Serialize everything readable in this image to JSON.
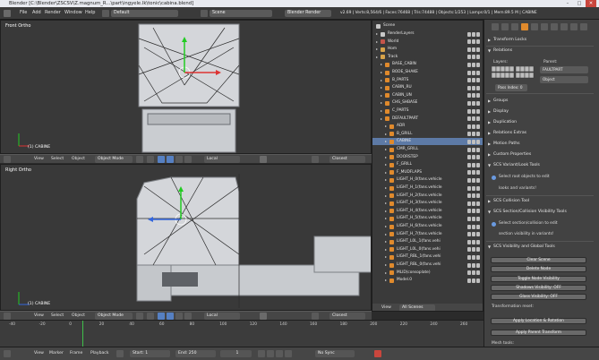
{
  "title": "Blender [C:\\Blender\\ZSCSV\\Z.magnum_R...\\part\\ingyele.lk\\tonic\\cabina.blend]",
  "window_controls": {
    "min": "–",
    "max": "□",
    "close": "✕"
  },
  "menu": [
    "File",
    "Add",
    "Render",
    "Window",
    "Help"
  ],
  "layout_select": "Default",
  "scene_select": "Scene",
  "engine_select": "Blender Render",
  "stats": "v2.69 | Verts:8,564/6 | Faces:76468 | Tris:74488 | Objects:1/253 | Lamps:0/1 | Mem:89.5 M | CABINE",
  "viewport_top": {
    "label": "Front Ortho",
    "object_name": "(1) CABINE"
  },
  "viewport_bottom": {
    "label": "Right Ortho",
    "object_name": "(1) CABINE"
  },
  "view_header": {
    "view": "View",
    "select": "Select",
    "object": "Object",
    "mode": "Object Mode",
    "orientation": "Local",
    "snap": "Closest"
  },
  "outliner": {
    "root": "Scene",
    "rows": [
      {
        "label": "RenderLayers",
        "indent": 1,
        "color": "#c8c8c8"
      },
      {
        "label": "World",
        "indent": 1,
        "color": "#c4554a"
      },
      {
        "label": "Hom",
        "indent": 1,
        "color": "#d7a34a"
      },
      {
        "label": "Track",
        "indent": 1,
        "color": "#d7a34a"
      },
      {
        "label": "BASE_CABIN",
        "indent": 2,
        "color": "#e08a2c"
      },
      {
        "label": "BODE_SHAKE",
        "indent": 2,
        "color": "#e08a2c"
      },
      {
        "label": "B_PARTS",
        "indent": 2,
        "color": "#e08a2c"
      },
      {
        "label": "CABIN_RU",
        "indent": 2,
        "color": "#e08a2c"
      },
      {
        "label": "CABIN_UN",
        "indent": 2,
        "color": "#e08a2c"
      },
      {
        "label": "CHS_SHBASE",
        "indent": 2,
        "color": "#e08a2c"
      },
      {
        "label": "C_PARTS",
        "indent": 2,
        "color": "#e08a2c"
      },
      {
        "label": "DEFAULTPART",
        "indent": 2,
        "color": "#e08a2c"
      },
      {
        "label": "ADR",
        "indent": 3,
        "color": "#e08a2c"
      },
      {
        "label": "B_GRILL",
        "indent": 3,
        "color": "#e08a2c"
      },
      {
        "label": "CABINE",
        "indent": 3,
        "color": "#e08a2c",
        "selected": true
      },
      {
        "label": "CMR_GRILL",
        "indent": 3,
        "color": "#e08a2c"
      },
      {
        "label": "DOORSTEP",
        "indent": 3,
        "color": "#e08a2c"
      },
      {
        "label": "F_GRILL",
        "indent": 3,
        "color": "#e08a2c"
      },
      {
        "label": "F_MUDFLAPS",
        "indent": 3,
        "color": "#e08a2c"
      },
      {
        "label": "LIGHT_H_0(fans.vehicle",
        "indent": 3,
        "color": "#e08a2c"
      },
      {
        "label": "LIGHT_H_1(fans.vehicle",
        "indent": 3,
        "color": "#e08a2c"
      },
      {
        "label": "LIGHT_H_2(fans.vehicle",
        "indent": 3,
        "color": "#e08a2c"
      },
      {
        "label": "LIGHT_H_3(fans.vehicle",
        "indent": 3,
        "color": "#e08a2c"
      },
      {
        "label": "LIGHT_H_4(fans.vehicle",
        "indent": 3,
        "color": "#e08a2c"
      },
      {
        "label": "LIGHT_H_5(fans.vehicle",
        "indent": 3,
        "color": "#e08a2c"
      },
      {
        "label": "LIGHT_H_6(fans.vehicle",
        "indent": 3,
        "color": "#e08a2c"
      },
      {
        "label": "LIGHT_H_7(fans.vehicle",
        "indent": 3,
        "color": "#e08a2c"
      },
      {
        "label": "LIGHT_L0L_1(fans.vehi",
        "indent": 3,
        "color": "#e08a2c"
      },
      {
        "label": "LIGHT_L0L_0(fans.vehi",
        "indent": 3,
        "color": "#e08a2c"
      },
      {
        "label": "LIGHT_RBL_1(fans.vehi",
        "indent": 3,
        "color": "#e08a2c"
      },
      {
        "label": "LIGHT_RBL_0(fans.vehi",
        "indent": 3,
        "color": "#e08a2c"
      },
      {
        "label": "MLID(consoplate)",
        "indent": 3,
        "color": "#e08a2c"
      },
      {
        "label": "Model.0",
        "indent": 3,
        "color": "#e08a2c"
      }
    ],
    "footer_view": "View",
    "footer_search": "All Scenes"
  },
  "properties": {
    "panels": [
      {
        "label": "Transform Locks",
        "open": false
      },
      {
        "label": "Relations",
        "open": true
      },
      {
        "label": "Groups",
        "open": false
      },
      {
        "label": "Display",
        "open": false
      },
      {
        "label": "Duplication",
        "open": false
      },
      {
        "label": "Relations Extras",
        "open": false
      },
      {
        "label": "Motion Paths",
        "open": false
      },
      {
        "label": "Custom Properties",
        "open": false
      },
      {
        "label": "SCS Variant/Look Tools",
        "open": true
      },
      {
        "label": "SCS Collision Tool",
        "open": false
      },
      {
        "label": "SCS Section/Collision Visibility Tools",
        "open": true
      },
      {
        "label": "SCS Visibility and Global Tools",
        "open": true
      }
    ],
    "relations": {
      "layers_label": "Layers:",
      "parent_label": "Parent:",
      "parent_value": "FAULTPART",
      "parent_type": "Object",
      "pass_index": "Pass Index: 0"
    },
    "variant_info": "Select root objects to edit",
    "variant_info2": "looks and variants!",
    "section_info": "Select section/collision to edit",
    "section_info2": "section visibility in variants!",
    "global_buttons": [
      "Clear Scene",
      "Delete Node",
      "Toggle Node Visibility",
      "Shadows Visibility: OFF",
      "Glass Visibility: OFF"
    ],
    "transformation_label": "Transformation reset:",
    "transform_buttons": [
      "Apply Location & Rotation",
      "Apply Parent Transform"
    ],
    "mesh_tools_label": "Mesh tools:"
  },
  "timeline": {
    "ticks": [
      "-40",
      "-20",
      "0",
      "20",
      "40",
      "60",
      "80",
      "100",
      "120",
      "140",
      "160",
      "180",
      "200",
      "220",
      "240",
      "260"
    ],
    "current_frame_marker": "1"
  },
  "status": {
    "view": "View",
    "marker": "Marker",
    "frame": "Frame",
    "playback": "Playback",
    "start": "Start: 1",
    "end": "End: 250",
    "current": "1",
    "sync": "No Sync"
  }
}
